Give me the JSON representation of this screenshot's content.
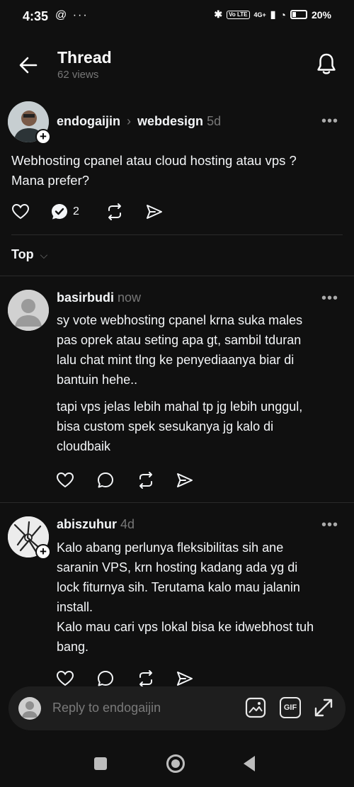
{
  "status_bar": {
    "time": "4:35",
    "left_icons": "threads-icon more-icon",
    "mini_label": "Vo LTE",
    "network": "4G+",
    "battery": "20%"
  },
  "header": {
    "title": "Thread",
    "views": "62 views"
  },
  "op": {
    "username": "endogaijin",
    "community": "webdesign",
    "age": "5d",
    "text_line1": "Webhosting cpanel atau cloud hosting atau vps ?",
    "text_line2": "Mana prefer?",
    "reply_count": "2"
  },
  "sort": {
    "label": "Top"
  },
  "replies": [
    {
      "username": "basirbudi",
      "age": "now",
      "lines": [
        "sy vote webhosting cpanel krna suka males",
        "pas oprek atau seting apa gt, sambil tduran",
        "lalu chat mint tlng ke penyediaanya biar di",
        "bantuin hehe..",
        "tapi vps jelas lebih mahal tp jg lebih unggul,",
        "bisa custom spek sesukanya jg kalo di",
        "cloudbaik"
      ]
    },
    {
      "username": "abiszuhur",
      "age": "4d",
      "lines": [
        "Kalo abang perlunya fleksibilitas sih ane",
        "saranin VPS, krn hosting kadang ada yg di",
        "lock fiturnya sih. Terutama kalo mau jalanin",
        "install.",
        "Kalo mau cari vps lokal bisa ke idwebhost tuh",
        "bang."
      ]
    }
  ],
  "reply_bar": {
    "placeholder": "Reply to endogaijin",
    "gif_label": "GIF"
  },
  "colors": {
    "background": "#101010",
    "text": "#f3f5f7",
    "muted": "#777777"
  }
}
